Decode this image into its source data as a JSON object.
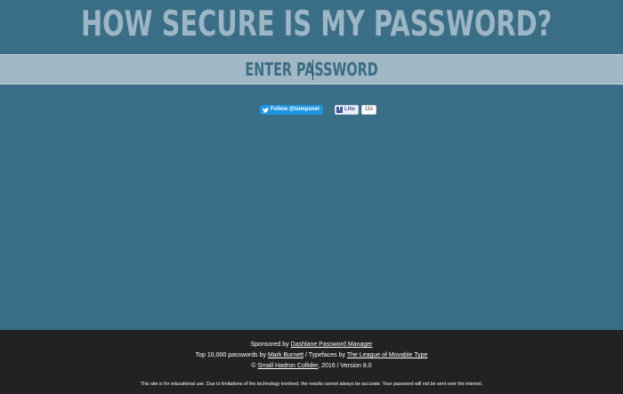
{
  "header": {
    "title": "HOW SECURE IS MY PASSWORD?"
  },
  "password": {
    "placeholder": "ENTER PASSWORD",
    "value": ""
  },
  "social": {
    "twitter_label": "Follow @tsimpsnet",
    "facebook_label": "Like",
    "facebook_count": "11k"
  },
  "footer": {
    "sponsored_prefix": "Sponsored by",
    "sponsor_link": "Dashlane Password Manager",
    "top_prefix": "Top 10,000 passwords by",
    "author_link": "Mark Burnett",
    "typefaces_prefix": "/ Typefaces by",
    "typeface_link": "The League of Movable Type",
    "copyright_symbol": "©",
    "company_link": "Small Hadron Collider",
    "copyright_suffix": ", 2016 / Version 8.0",
    "disclaimer": "This site is for educational use. Due to limitations of the technology involved, the results cannot always be accurate. Your password will not be sent over the internet."
  },
  "colors": {
    "background": "#3a6d86",
    "title": "#9db6c5",
    "band": "#a1b7c3",
    "footer": "#222222"
  }
}
